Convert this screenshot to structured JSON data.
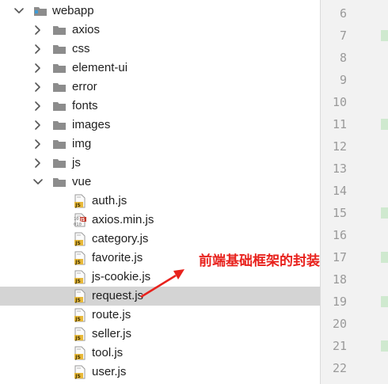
{
  "tree": {
    "root": {
      "name": "webapp",
      "expanded": true
    },
    "folders": [
      {
        "name": "axios",
        "expanded": false
      },
      {
        "name": "css",
        "expanded": false
      },
      {
        "name": "element-ui",
        "expanded": false
      },
      {
        "name": "error",
        "expanded": false
      },
      {
        "name": "fonts",
        "expanded": false
      },
      {
        "name": "images",
        "expanded": false
      },
      {
        "name": "img",
        "expanded": false
      },
      {
        "name": "js",
        "expanded": false
      },
      {
        "name": "vue",
        "expanded": true
      }
    ],
    "vue_files": [
      {
        "name": "auth.js",
        "type": "js",
        "selected": false
      },
      {
        "name": "axios.min.js",
        "type": "minjs",
        "selected": false
      },
      {
        "name": "category.js",
        "type": "js",
        "selected": false
      },
      {
        "name": "favorite.js",
        "type": "js",
        "selected": false
      },
      {
        "name": "js-cookie.js",
        "type": "js",
        "selected": false
      },
      {
        "name": "request.js",
        "type": "js",
        "selected": true
      },
      {
        "name": "route.js",
        "type": "js",
        "selected": false
      },
      {
        "name": "seller.js",
        "type": "js",
        "selected": false
      },
      {
        "name": "tool.js",
        "type": "js",
        "selected": false
      },
      {
        "name": "user.js",
        "type": "js",
        "selected": false
      }
    ]
  },
  "gutter": {
    "line_numbers": [
      "6",
      "7",
      "8",
      "9",
      "10",
      "11",
      "12",
      "13",
      "14",
      "15",
      "16",
      "17",
      "18",
      "19",
      "20",
      "21",
      "22"
    ]
  },
  "annotation": {
    "text": "前端基础框架的封装",
    "color": "#e8221d"
  },
  "colors": {
    "selection": "#d4d4d4",
    "folder": "#8c8c8c",
    "js_badge": "#e8b93a",
    "gutter_bg": "#f2f2f2",
    "fold_marker": "#cfe9cf"
  }
}
